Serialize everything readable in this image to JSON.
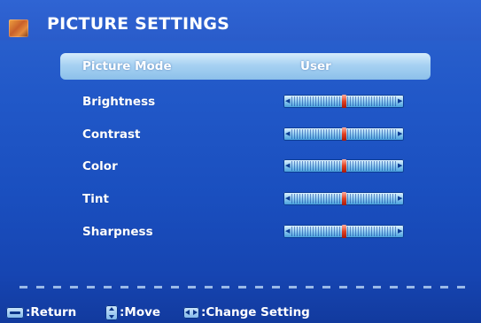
{
  "title": "PICTURE SETTINGS",
  "menu": [
    {
      "label": "Picture Mode",
      "value": "User",
      "selected": true
    },
    {
      "label": "Brightness",
      "level": 0.5
    },
    {
      "label": "Contrast",
      "level": 0.5
    },
    {
      "label": "Color",
      "level": 0.5
    },
    {
      "label": "Tint",
      "level": 0.5
    },
    {
      "label": "Sharpness",
      "level": 0.5
    }
  ],
  "footer": {
    "return_label": ":Return",
    "move_label": ":Move",
    "change_label": ":Change Setting"
  },
  "icons": {
    "title": "picture-icon",
    "return": "menu-button-icon",
    "move": "up-down-arrows-icon",
    "change": "left-right-arrows-icon"
  },
  "colors": {
    "background": "#2158c8",
    "highlight": "#a7d1f2",
    "slider_knob": "#e04020",
    "text": "#ffffff"
  }
}
